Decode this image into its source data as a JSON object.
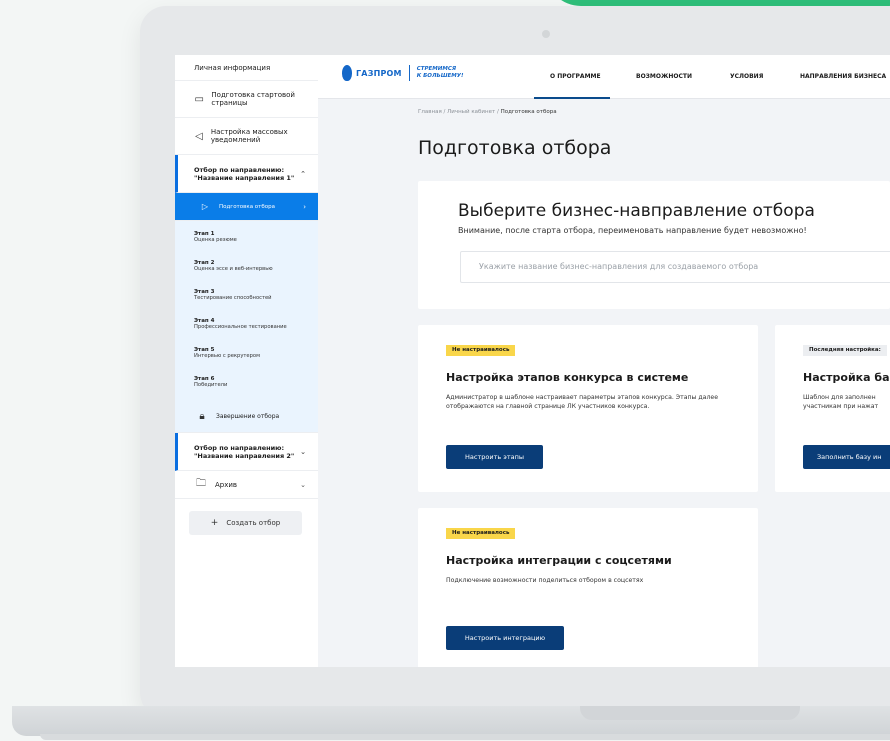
{
  "sidebar": {
    "personal_info": "Личная информация",
    "start_page": "Подготовка стартовой страницы",
    "mass_notifications": "Настройка массовых уведомлений",
    "direction1": "Отбор по направлению: \"Название направления 1\"",
    "active_item": "Подготовка отбора",
    "stages": [
      {
        "title": "Этап 1",
        "desc": "Оценка резюме"
      },
      {
        "title": "Этап 2",
        "desc": "Оценка эссе и веб-интервью"
      },
      {
        "title": "Этап 3",
        "desc": "Тестирование способностей"
      },
      {
        "title": "Этап 4",
        "desc": "Профессиональное тестирование"
      },
      {
        "title": "Этап 5",
        "desc": "Интервью с рекрутером"
      },
      {
        "title": "Этап 6",
        "desc": "Победители"
      }
    ],
    "finish": "Завершение отбора",
    "direction2": "Отбор по направлению: \"Название направления 2\"",
    "archive": "Архив",
    "create": "Создать отбор"
  },
  "logo": {
    "brand": "ГАЗПРОМ",
    "slogan_line1": "СТРЕМИМСЯ",
    "slogan_line2": "К БОЛЬШЕМУ!"
  },
  "nav": {
    "tabs": [
      "О ПРОГРАММЕ",
      "ВОЗМОЖНОСТИ",
      "УСЛОВИЯ",
      "НАПРАВЛЕНИЯ БИЗНЕСА"
    ]
  },
  "breadcrumb": {
    "home": "Главная",
    "cabinet": "Личный кабинет",
    "current": "Подготовка отбора",
    "sep": "/"
  },
  "page_title": "Подготовка отбора",
  "choose": {
    "title": "Выберите бизнес-навправление отбора",
    "warning": "Внимание, после старта отбора, переименовать направление будет невозможно!",
    "placeholder": "Укажите название бизнес-направления для создаваемого отбора"
  },
  "cards": {
    "stages": {
      "badge": "Не настраивалось",
      "title": "Настройка этапов конкурса в системе",
      "desc": "Администратор в шаблоне настраивает параметры этапов конкурса. Этапы далее отображаются на главной странице ЛК участников конкурса.",
      "button": "Настроить этапы"
    },
    "base": {
      "badge": "Последняя настройка:",
      "title": "Настройка баз",
      "desc": "Шаблон для заполнен участникам при нажат",
      "button": "Заполнить базу ин"
    },
    "social": {
      "badge": "Не настраивалось",
      "title": "Настройка интеграции с соцсетями",
      "desc": "Подключение возможности поделиться отбором в соцсетях",
      "button": "Настроить интеграцию"
    }
  }
}
